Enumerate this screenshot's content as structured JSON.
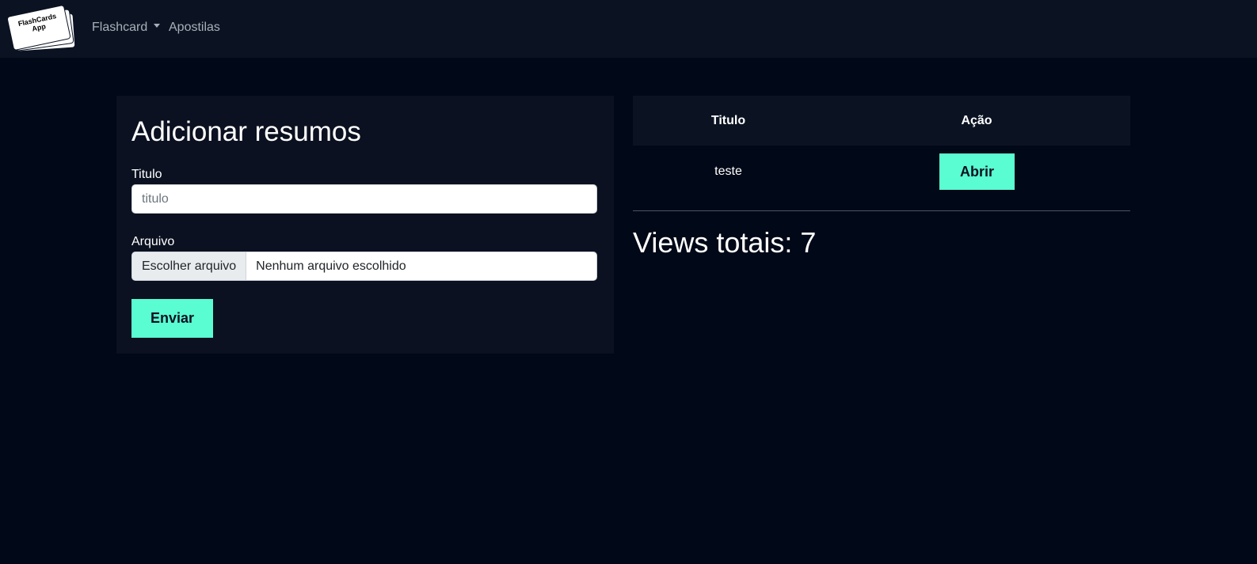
{
  "navbar": {
    "logo_text": "FlashCards App",
    "links": [
      {
        "label": "Flashcard",
        "has_dropdown": true,
        "icon": "caret-down-icon"
      },
      {
        "label": "Apostilas",
        "has_dropdown": false
      }
    ]
  },
  "form": {
    "title": "Adicionar resumos",
    "titulo_label": "Titulo",
    "titulo_placeholder": "titulo",
    "titulo_value": "",
    "arquivo_label": "Arquivo",
    "file_button_label": "Escolher arquivo",
    "file_status": "Nenhum arquivo escolhido",
    "submit_label": "Enviar"
  },
  "table": {
    "headers": [
      "Titulo",
      "Ação"
    ],
    "rows": [
      {
        "titulo": "teste",
        "action_label": "Abrir"
      }
    ]
  },
  "views_text": "Views totais: 7",
  "colors": {
    "background": "#010817",
    "navbar": "#0b1323",
    "panel": "#0b1120",
    "accent": "#5afcd2"
  }
}
